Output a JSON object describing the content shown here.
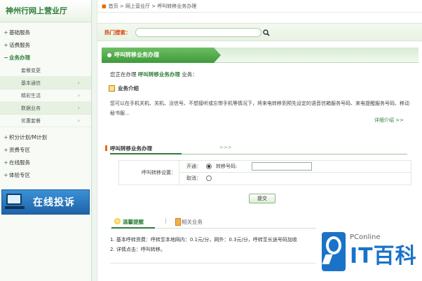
{
  "sidebar": {
    "title": "神州行网上营业厅",
    "items_top": [
      "基础服务",
      "话费服务"
    ],
    "open_item": "业务办理",
    "sub_items": [
      {
        "label": "套餐变更",
        "arrow": false
      },
      {
        "label": "基本通信",
        "arrow": true
      },
      {
        "label": "精彩生活",
        "arrow": true
      },
      {
        "label": "数据业务",
        "arrow": true
      },
      {
        "label": "优惠套餐",
        "arrow": true
      }
    ],
    "items_bottom": [
      "积分计划/M计划",
      "资费专区",
      "在线服务",
      "体验专区"
    ],
    "banner": "在线投诉"
  },
  "breadcrumb": {
    "home": "首页",
    "sep": ">",
    "level1": "网上营业厅",
    "level2": "呼叫转移业务办理"
  },
  "search": {
    "label": "热门搜索：",
    "value": ""
  },
  "section": {
    "title": "呼叫转移业务办理",
    "intro_prefix": "您正在办理",
    "intro_service": "呼叫转移业务办理",
    "intro_suffix": "业务：",
    "intro_head": "业务介绍",
    "description": "您可以在手机关机、关机、没信号、不想接听或忘带手机等情况下，将来电转移到预先设定的语音信箱服务号码、来电提醒服务号码、移动秘书服…",
    "more": "详细介绍 >>"
  },
  "form": {
    "tab": "呼叫转移业务办理",
    "chev": ">>>",
    "setting_label": "呼叫转移设置：",
    "opt_enable": "开通：",
    "opt_cancel": "取消：",
    "number_label": "转移号码:",
    "number_value": "",
    "enable_selected": true,
    "submit": "提交"
  },
  "tips": {
    "tab_active": "温馨提醒",
    "tab_other": "相关业务",
    "sep": "|",
    "lines": [
      "1. 基本呼转资费：呼转至本地网内：0.1元/分，网外：0.3元/分，呼转至长途号码加收",
      "2. 详情点击：呼叫转移。"
    ]
  },
  "watermark": {
    "small": "PConline",
    "big": "IT百科"
  }
}
